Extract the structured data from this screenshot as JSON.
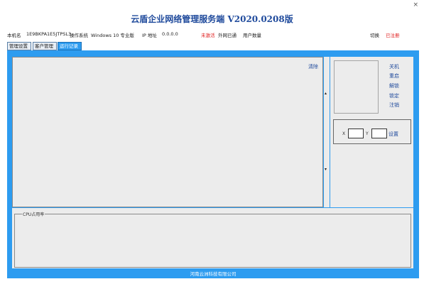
{
  "window": {
    "close_glyph": "×"
  },
  "app_title": "云盾企业网络管理服务端 V2020.0208版",
  "info_bar": {
    "host_label": "本机名",
    "host_value": "1E9BKPA1E5JTPSL3",
    "os_label": "操作系统",
    "os_value": "Windows 10 专业版",
    "ip_label": "IP 地址",
    "ip_value": "0.0.0.0",
    "status_badge": "未激活",
    "network_status": "外网已通",
    "user_count_label": "用户数量",
    "switch_label": "切换",
    "switch_value": "已注册"
  },
  "tabs": [
    {
      "label": "管理设置",
      "active": false
    },
    {
      "label": "客户管理",
      "active": false
    },
    {
      "label": "运行记录",
      "active": true
    }
  ],
  "log_panel": {
    "clear_label": "清除"
  },
  "commands": {
    "shutdown": "关机",
    "restart": "重启",
    "unlock": "解锁",
    "lock": "锁定",
    "logout": "注销"
  },
  "coords": {
    "x_label": "X",
    "y_label": "Y",
    "x_value": "",
    "y_value": "",
    "set_label": "设置"
  },
  "cpu_panel": {
    "label": "CPU占用率"
  },
  "footer": "河南云洲科技有限公司",
  "colors": {
    "accent": "#2d9cf0",
    "title": "#1f4a9c",
    "panel": "#ececec",
    "alert": "#e02020"
  }
}
